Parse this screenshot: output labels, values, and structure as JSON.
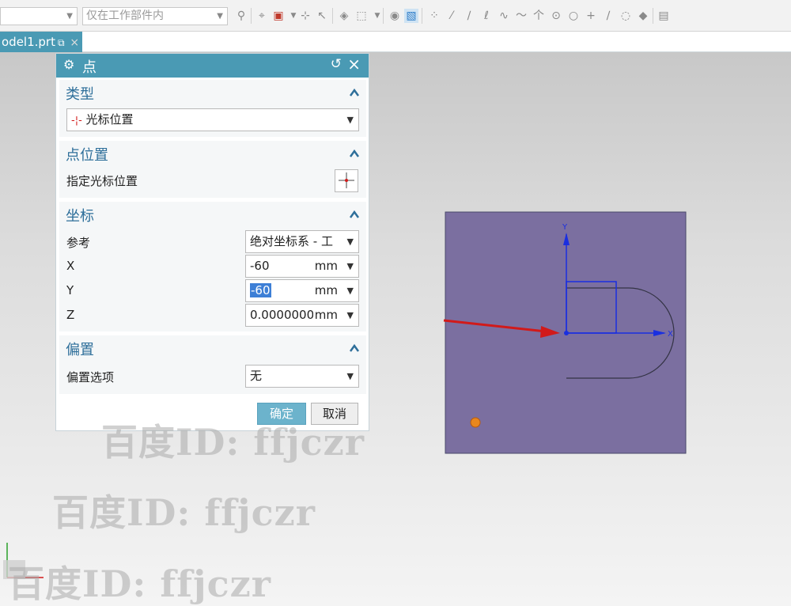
{
  "toolbar": {
    "filter_combo_value": "",
    "scope_combo_value": "仅在工作部件内",
    "icons": [
      "selection-filter-icon",
      "snap-point-icon",
      "add-point-icon",
      "snap-midpoint-icon",
      "lasso-icon",
      "box-select-icon",
      "shaded-view-icon",
      "solid-body-icon",
      "scatter-point-icon",
      "line-icon",
      "line-slash-icon",
      "curve-icon",
      "spline-icon",
      "wave-icon",
      "intersection-icon",
      "circle-center-icon",
      "circle-point-icon",
      "plus-icon",
      "diagonal-icon",
      "tangent-icon",
      "quadrant-icon",
      "grid-icon"
    ]
  },
  "tab": {
    "label": "odel1.prt",
    "close": "×"
  },
  "dialog": {
    "title": "点",
    "sections": {
      "type": {
        "header": "类型",
        "value": "光标位置"
      },
      "point_location": {
        "header": "点位置",
        "label": "指定光标位置"
      },
      "coords": {
        "header": "坐标",
        "reference_label": "参考",
        "reference_value": "绝对坐标系 - 工",
        "x_label": "X",
        "x_value": "-60",
        "x_unit": "mm",
        "y_label": "Y",
        "y_value": "-60",
        "y_unit": "mm",
        "z_label": "Z",
        "z_value": "0.0000000",
        "z_unit": "mm"
      },
      "offset": {
        "header": "偏置",
        "option_label": "偏置选项",
        "option_value": "无"
      }
    },
    "ok_label": "确定",
    "cancel_label": "取消"
  },
  "graphics": {
    "sketch_fill": "#7b6fa0",
    "axis_color": "#1a2fe0",
    "arrow_color": "#d11a1a",
    "x_axis_label": "X",
    "y_axis_label": "Y"
  },
  "watermarks": [
    "百度ID: ffjczr",
    "百度ID: ffjczr",
    "百度ID: ffjczr"
  ]
}
